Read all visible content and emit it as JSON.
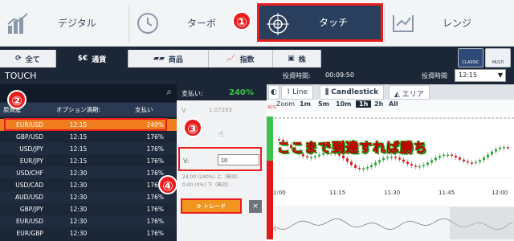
{
  "mode_bar": {
    "items": [
      {
        "label": "デジタル"
      },
      {
        "label": "ターボ"
      },
      {
        "label": "タッチ"
      },
      {
        "label": "レンジ"
      }
    ]
  },
  "nav_tabs": [
    "全て",
    "通貨",
    "商品",
    "指数",
    "株"
  ],
  "view_buttons": [
    "CLASSIC",
    "MULTI"
  ],
  "touch": {
    "title": "TOUCH",
    "invest_time_label": "投資時間:",
    "invest_time_value": "00:09:50",
    "invest_dur_label": "投資時間",
    "invest_dur_value": "12:15"
  },
  "table": {
    "headers": [
      "原資産",
      "オプション満期:",
      "支払い"
    ],
    "rows": [
      {
        "asset": "EUR/USD",
        "expiry": "12:15",
        "pay": "240%"
      },
      {
        "asset": "GBP/USD",
        "expiry": "12:15",
        "pay": "176%"
      },
      {
        "asset": "USD/JPY",
        "expiry": "12:15",
        "pay": "176%"
      },
      {
        "asset": "EUR/JPY",
        "expiry": "12:15",
        "pay": "176%"
      },
      {
        "asset": "USD/CHF",
        "expiry": "12:30",
        "pay": "176%"
      },
      {
        "asset": "USD/CAD",
        "expiry": "12:30",
        "pay": "176%"
      },
      {
        "asset": "AUD/USD",
        "expiry": "12:30",
        "pay": "176%"
      },
      {
        "asset": "GBP/JPY",
        "expiry": "12:30",
        "pay": "176%"
      },
      {
        "asset": "EUR/USD",
        "expiry": "12:30",
        "pay": "176%"
      },
      {
        "asset": "EUR/GBP",
        "expiry": "12:30",
        "pay": "176%"
      }
    ]
  },
  "mid": {
    "pay_label": "支払い:",
    "pay_value": "240%",
    "v1_label": "V",
    "v1_value": "1.07293",
    "v_input_label": "V:",
    "v_input_value": "10",
    "up_info": "24.00 (240%) 上（無効）",
    "down_info": "0.00 (0%) 下（無効）",
    "trade_label": "トレード",
    "cancel": "×"
  },
  "chart": {
    "tabs": [
      "Line",
      "Candlestick",
      "エリア"
    ],
    "zoom_label": "Zoom",
    "zoom": [
      "1m",
      "5m",
      "10m",
      "1h",
      "2h",
      "All"
    ],
    "zoom_active": "1h",
    "pct_top": "41%",
    "pct_bot": "59%",
    "times": [
      "1:00",
      "11:15",
      "11:30",
      "11:45",
      "12:00"
    ],
    "overlay_text": "ここまで到達すれば勝ち"
  },
  "markers": [
    "①",
    "②",
    "③",
    "④"
  ],
  "colors": {
    "accent": "#e81e1e",
    "up": "#3cc34a",
    "down": "#e01a1a",
    "orange": "#f07d1e"
  }
}
